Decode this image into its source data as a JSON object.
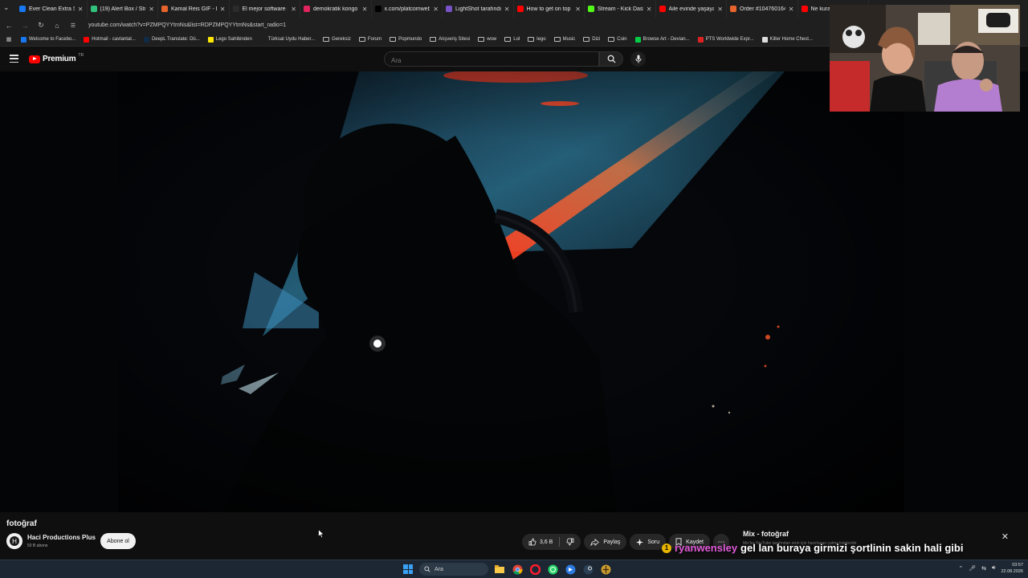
{
  "browser": {
    "tabs": [
      {
        "label": "Ever Clean Extra Str",
        "color": "#1877f2"
      },
      {
        "label": "(19) Alert Box / Str",
        "color": "#31c27c"
      },
      {
        "label": "Kamal Reis GIF - Fi",
        "color": "#e8642c"
      },
      {
        "label": "El mejor software p",
        "color": "#2b2b2b"
      },
      {
        "label": "demokratik kongo",
        "color": "#e0245e"
      },
      {
        "label": "x.com/platcomweb",
        "color": "#000000"
      },
      {
        "label": "LightShot tarafındı",
        "color": "#7a52c7"
      },
      {
        "label": "How to get on top",
        "color": "#ff0000"
      },
      {
        "label": "Stream - Kick Dash",
        "color": "#53fc18"
      },
      {
        "label": "Aile evinde yaşayan",
        "color": "#ff0000"
      },
      {
        "label": "Order #104760164",
        "color": "#e8642c"
      },
      {
        "label": "Ne kural",
        "color": "#ff0000"
      }
    ],
    "url": "youtube.com/watch?v=PZMPQYYtmNs&list=RDPZMPQYYtmNs&start_radio=1",
    "bookmarks": [
      {
        "label": "Welcome to Facebo...",
        "icon": "facebook",
        "color": "#1877f2"
      },
      {
        "label": "Hotmail - cavlantat...",
        "icon": "hotmail",
        "color": "#ff0000"
      },
      {
        "label": "DeepL Translate: Dü...",
        "icon": "deepl",
        "color": "#0f2b46"
      },
      {
        "label": "Lego Sahibinden",
        "icon": "sahibinden",
        "color": "#ffe800"
      },
      {
        "label": "Türksat Uydu Haber...",
        "icon": "turksat",
        "color": "#1f1f1f"
      },
      {
        "label": "Gereksiz",
        "icon": "folder"
      },
      {
        "label": "Forum",
        "icon": "folder"
      },
      {
        "label": "Popmundo",
        "icon": "folder"
      },
      {
        "label": "Alışveriş Sitesi",
        "icon": "folder"
      },
      {
        "label": "wow",
        "icon": "folder"
      },
      {
        "label": "Lol",
        "icon": "folder"
      },
      {
        "label": "lego",
        "icon": "folder"
      },
      {
        "label": "Music",
        "icon": "folder"
      },
      {
        "label": "Dizi",
        "icon": "folder"
      },
      {
        "label": "Coin",
        "icon": "folder"
      },
      {
        "label": "Browse Art - Devian...",
        "icon": "deviantart",
        "color": "#05cc47"
      },
      {
        "label": "PTS Worldwide Expr...",
        "icon": "pts",
        "color": "#d22"
      },
      {
        "label": "Killer Home Chest...",
        "icon": "globe",
        "color": "#ddd"
      }
    ]
  },
  "youtube": {
    "logo": "Premium",
    "region": "TR",
    "search_placeholder": "Ara"
  },
  "video": {
    "title": "fotoğraf",
    "channel": "Haci Productions Plus",
    "subscribers": "50 B abone",
    "subscribe_label": "Abone ol",
    "likes": "3,6 B",
    "share_label": "Paylaş",
    "ask_label": "Soru",
    "save_label": "Kaydet"
  },
  "mix": {
    "title": "Mix - fotoğraf",
    "subtitle": "Mix'ler YouTube tarafından sizin için hazırlanan çalma listeleridir"
  },
  "chat": {
    "badge": "1",
    "user": "ryanwensley",
    "message": "gel lan buraya girmizi şortlinin sakin hali gibi"
  },
  "taskbar": {
    "search": "Ara",
    "time": "03:57",
    "date": "22.08.2026"
  }
}
